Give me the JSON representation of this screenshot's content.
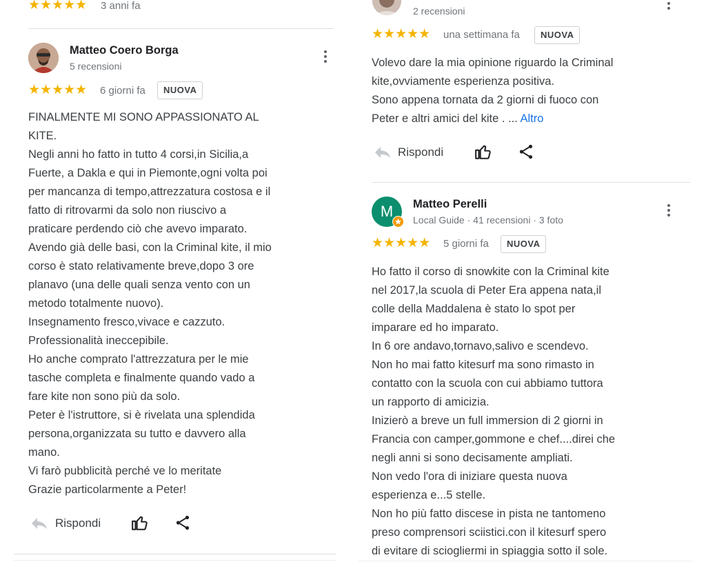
{
  "left": {
    "top_review": {
      "stars": "★★★★★",
      "time": "3 anni fa"
    },
    "review": {
      "author": "Matteo Coero Borga",
      "sub": "5 recensioni",
      "stars": "★★★★★",
      "time": "6 giorni fa",
      "badge": "NUOVA",
      "text": [
        "FINALMENTE MI SONO APPASSIONATO AL",
        "KITE.",
        "Negli anni ho fatto in tutto 4 corsi,in Sicilia,a",
        "Fuerte, a Dakla e qui in Piemonte,ogni volta poi",
        "per mancanza di tempo,attrezzatura costosa e il",
        "fatto di ritrovarmi da solo non riuscivo a",
        "praticare perdendo ciò che avevo imparato.",
        "Avendo già delle basi, con la Criminal kite, il mio",
        "corso è stato relativamente breve,dopo 3 ore",
        "planavo (una delle quali senza vento con un",
        "metodo totalmente nuovo).",
        "Insegnamento fresco,vivace e cazzuto.",
        "Professionalità ineccepibile.",
        "Ho anche comprato l'attrezzatura per le mie",
        "tasche completa e finalmente quando vado a",
        "fare kite non sono più da solo.",
        "Peter è l'istruttore, si è rivelata una splendida",
        "persona,organizzata su tutto e davvero alla",
        "mano.",
        "Vi farò pubblicità perché ve lo meritate",
        "Grazie particolarmente a Peter!"
      ],
      "reply_label": "Rispondi"
    }
  },
  "right": {
    "top_review": {
      "sub": "2 recensioni",
      "stars": "★★★★★",
      "time": "una settimana fa",
      "badge": "NUOVA",
      "text": [
        "Volevo dare la mia opinione riguardo la Criminal",
        "kite,ovviamente esperienza positiva.",
        "Sono appena tornata da 2 giorni di fuoco con"
      ],
      "last_line": "Peter e altri amici del kite . ...",
      "more": "Altro",
      "reply_label": "Rispondi"
    },
    "review": {
      "author": "Matteo Perelli",
      "avatar_letter": "M",
      "sub": "Local Guide · 41 recensioni · 3 foto",
      "stars": "★★★★★",
      "time": "5 giorni fa",
      "badge": "NUOVA",
      "text": [
        "Ho fatto il corso di snowkite con la Criminal kite",
        "nel 2017,la scuola di Peter Era appena nata,il",
        "colle della Maddalena è stato lo spot per",
        "imparare ed ho imparato.",
        "In 6 ore andavo,tornavo,salivo e scendevo.",
        "Non ho mai fatto kitesurf ma sono rimasto in",
        "contatto con la scuola con cui abbiamo tuttora",
        "un rapporto di amicizia.",
        "Inizierò a breve un full immersion di 2 giorni in",
        "Francia con camper,gommone e chef....direi che",
        "negli anni si sono decisamente ampliati.",
        "Non vedo l'ora di iniziare questa nuova",
        "esperienza e...5 stelle.",
        "Non ho più fatto discese in pista ne tantomeno",
        "preso comprensori sciistici.con il kitesurf spero",
        "di evitare di sciogliermi in spiaggia sotto il sole."
      ]
    }
  },
  "colors": {
    "star": "#f4b400",
    "link": "#1a73e8",
    "avatar_green": "#0b8f6e",
    "badge_orange": "#f29900"
  },
  "icons": [
    "reply-arrow-icon",
    "thumbs-up-icon",
    "share-icon",
    "more-vert-icon",
    "local-guide-star-icon"
  ]
}
